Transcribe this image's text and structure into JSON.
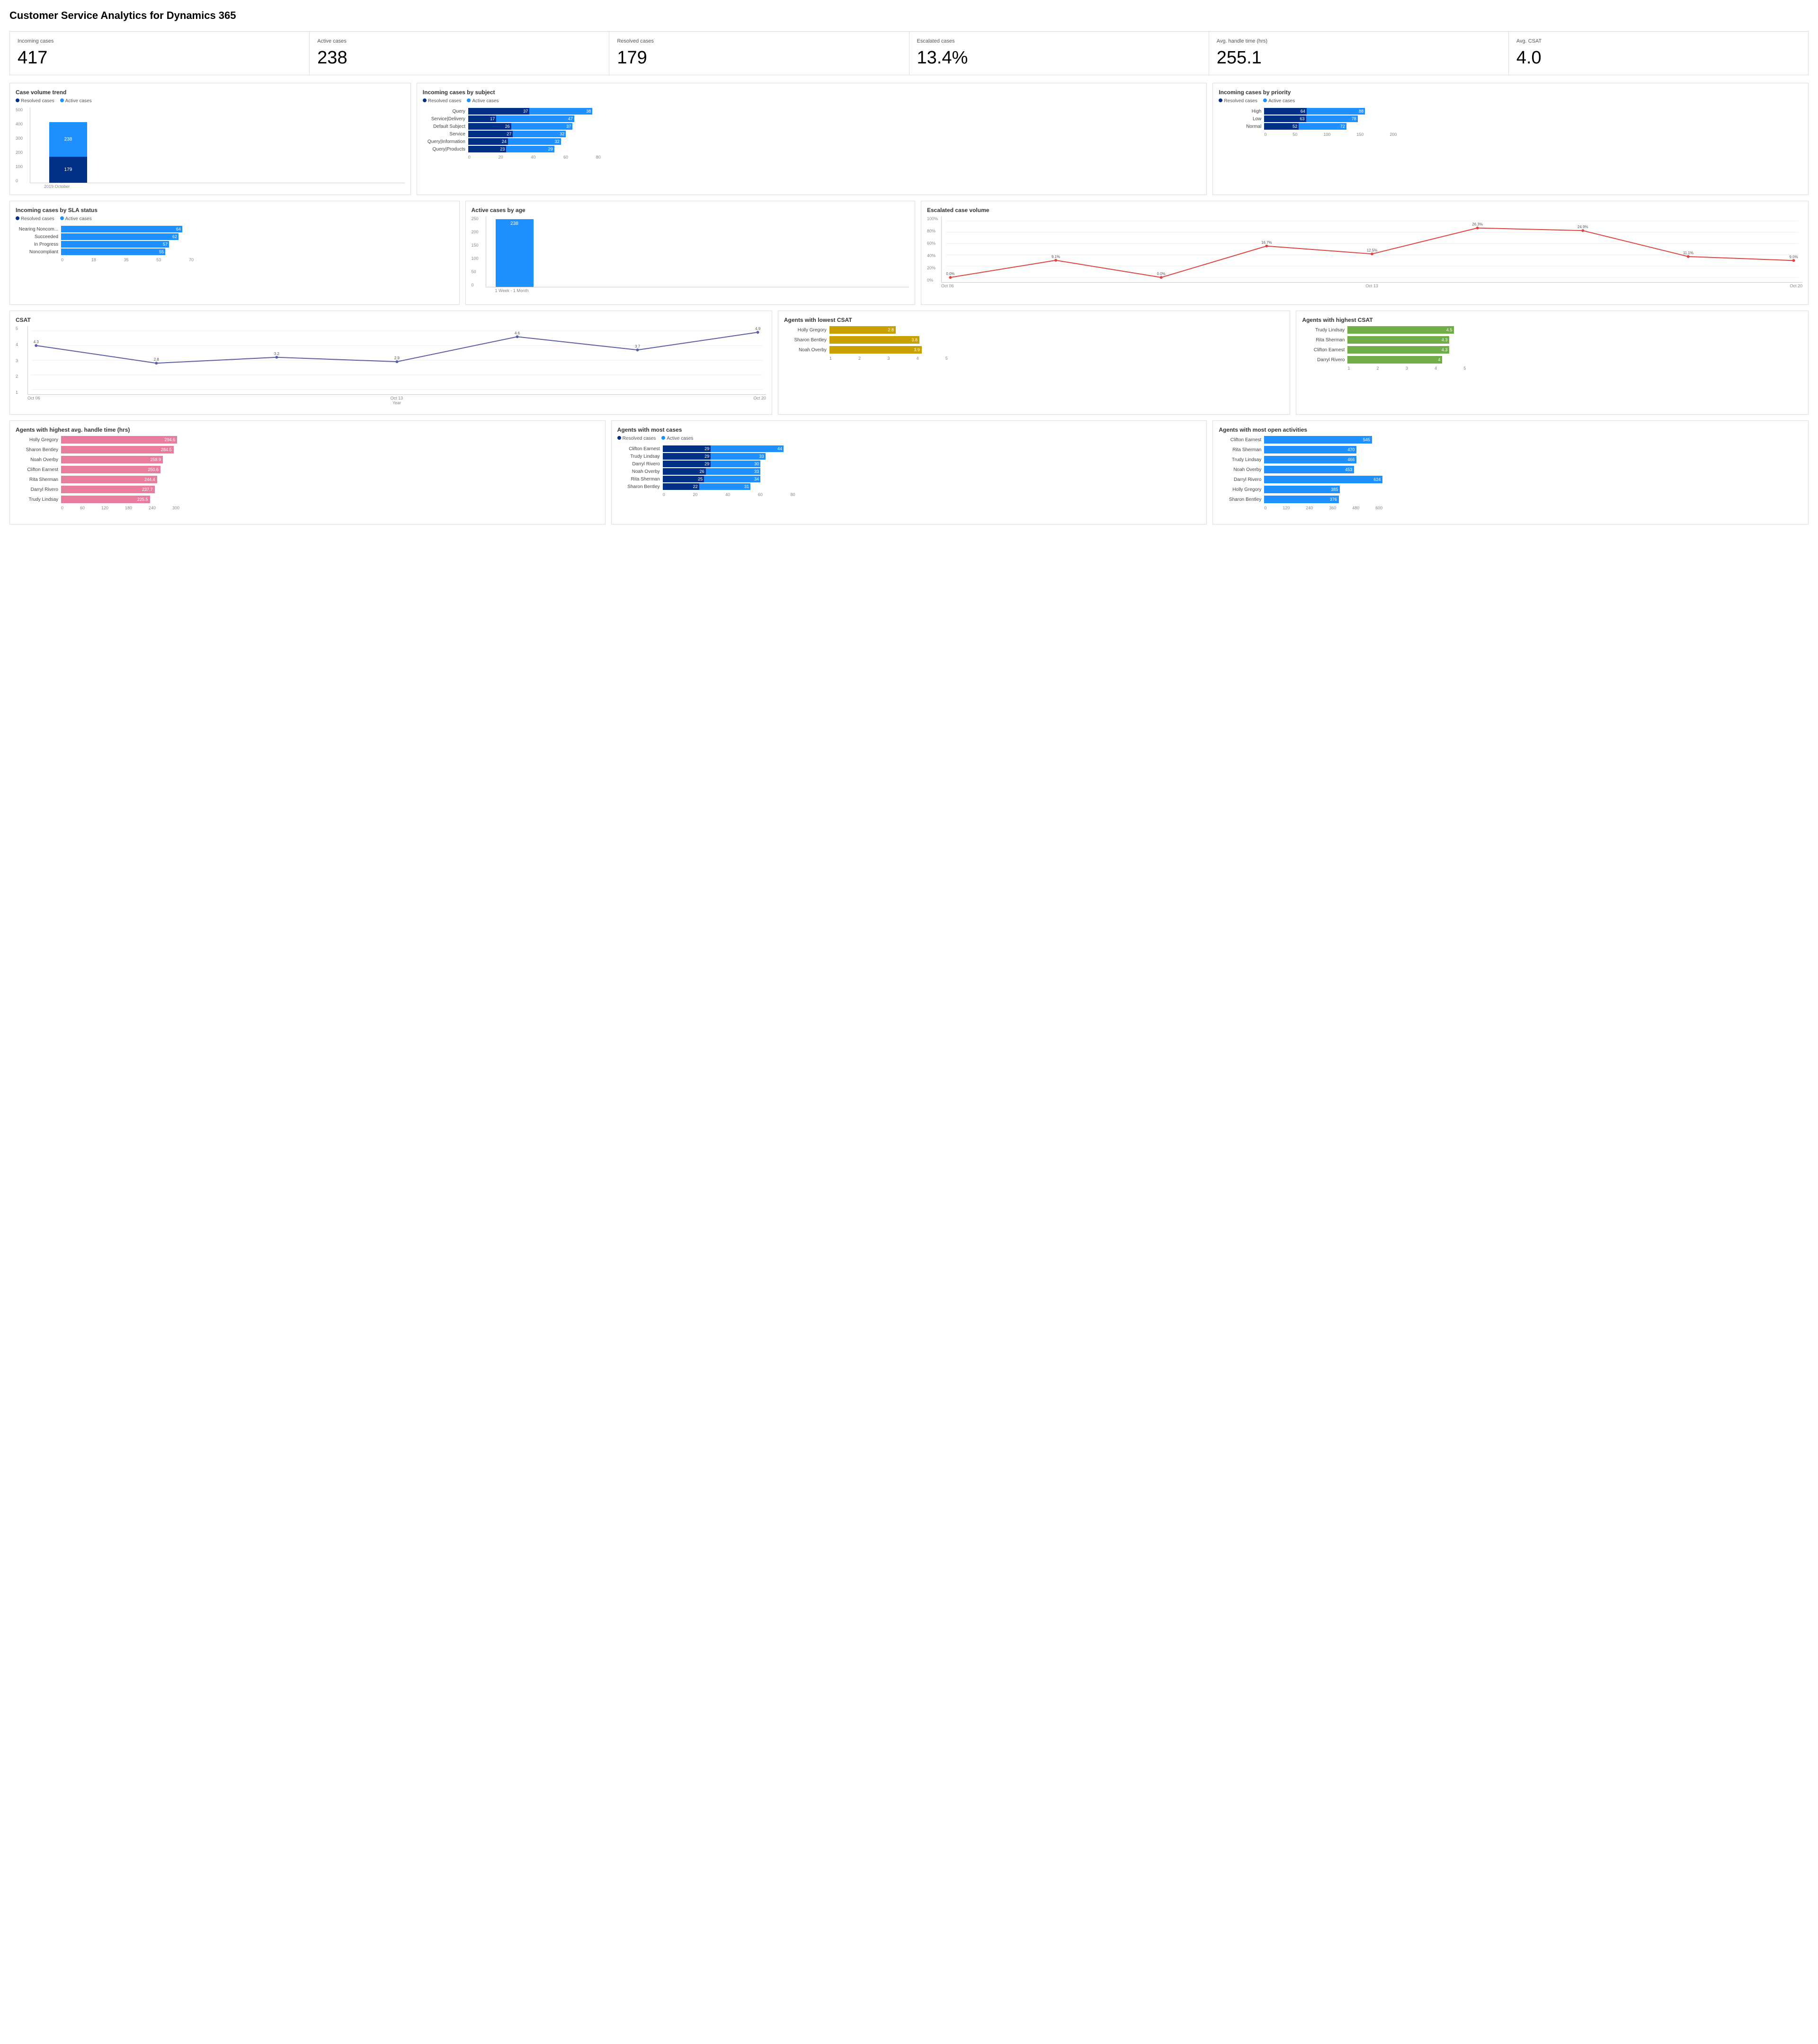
{
  "title": "Customer Service Analytics for Dynamics 365",
  "kpis": [
    {
      "label": "Incoming cases",
      "value": "417"
    },
    {
      "label": "Active cases",
      "value": "238"
    },
    {
      "label": "Resolved cases",
      "value": "179"
    },
    {
      "label": "Escalated cases",
      "value": "13.4%"
    },
    {
      "label": "Avg. handle time (hrs)",
      "value": "255.1"
    },
    {
      "label": "Avg. CSAT",
      "value": "4.0"
    }
  ],
  "colors": {
    "resolved": "#003087",
    "active": "#1e90ff",
    "green": "#70ad47",
    "yellow": "#c8a000",
    "pink": "#e87d9e",
    "escalated_line": "#d55"
  },
  "case_volume_trend": {
    "title": "Case volume trend",
    "legend": [
      "Resolved cases",
      "Active cases"
    ],
    "bar_label": "2019 October",
    "resolved_val": "179",
    "active_val": "238",
    "resolved_pct": 43,
    "active_pct": 57
  },
  "incoming_by_subject": {
    "title": "Incoming cases by subject",
    "legend": [
      "Resolved cases",
      "Active cases"
    ],
    "rows": [
      {
        "label": "Query",
        "resolved": 37,
        "active": 38
      },
      {
        "label": "Service|Delivery",
        "resolved": 17,
        "active": 47
      },
      {
        "label": "Default Subject",
        "resolved": 26,
        "active": 37
      },
      {
        "label": "Service",
        "resolved": 27,
        "active": 32
      },
      {
        "label": "Query|Information",
        "resolved": 24,
        "active": 32
      },
      {
        "label": "Query|Products",
        "resolved": 23,
        "active": 29
      }
    ],
    "x_max": 80
  },
  "incoming_by_priority": {
    "title": "Incoming cases by priority",
    "legend": [
      "Resolved cases",
      "Active cases"
    ],
    "rows": [
      {
        "label": "High",
        "resolved": 64,
        "active": 88
      },
      {
        "label": "Low",
        "resolved": 63,
        "active": 78
      },
      {
        "label": "Normal",
        "resolved": 52,
        "active": 72
      }
    ],
    "x_max": 200
  },
  "incoming_by_sla": {
    "title": "Incoming cases by SLA status",
    "legend": [
      "Resolved cases",
      "Active cases"
    ],
    "rows": [
      {
        "label": "Nearing Noncom...",
        "resolved": 0,
        "active": 64
      },
      {
        "label": "Succeeded",
        "resolved": 0,
        "active": 62
      },
      {
        "label": "In Progress",
        "resolved": 0,
        "active": 57
      },
      {
        "label": "Noncompliant",
        "resolved": 0,
        "active": 55
      }
    ],
    "x_max": 70
  },
  "active_by_age": {
    "title": "Active cases by age",
    "bar_label": "1 Week - 1 Month",
    "value": "238",
    "y_labels": [
      "0",
      "50",
      "100",
      "150",
      "200",
      "250"
    ]
  },
  "escalated_volume": {
    "title": "Escalated case volume",
    "points": [
      {
        "x": 0,
        "y": 0.0,
        "label": "0.0%",
        "date": "Oct 06"
      },
      {
        "x": 1,
        "y": 9.1,
        "label": "9.1%"
      },
      {
        "x": 2,
        "y": 0.0,
        "label": "0.0%"
      },
      {
        "x": 3,
        "y": 16.7,
        "label": "16.7%"
      },
      {
        "x": 4,
        "y": 12.5,
        "label": "12.5%",
        "date": "Oct 13"
      },
      {
        "x": 5,
        "y": 26.3,
        "label": "26.3%"
      },
      {
        "x": 6,
        "y": 24.9,
        "label": "24.9%"
      },
      {
        "x": 7,
        "y": 11.1,
        "label": "11.1%"
      },
      {
        "x": 8,
        "y": 9.0,
        "label": "9.0%",
        "date": "Oct 20"
      }
    ],
    "y_labels": [
      "0%",
      "20%",
      "40%",
      "60%",
      "80%",
      "100%"
    ]
  },
  "csat": {
    "title": "CSAT",
    "x_label": "Year",
    "points": [
      {
        "x": 0,
        "y": 4.0,
        "label": "4.3",
        "date": "Oct 06"
      },
      {
        "x": 1,
        "y": 2.8,
        "label": "2.8"
      },
      {
        "x": 2,
        "y": 3.2,
        "label": "3.2"
      },
      {
        "x": 3,
        "y": 2.9,
        "label": "2.9"
      },
      {
        "x": 4,
        "y": 4.6,
        "label": "4.6",
        "date": "Oct 13"
      },
      {
        "x": 5,
        "y": 3.7,
        "label": "3.7"
      },
      {
        "x": 6,
        "y": 4.9,
        "label": "4.9",
        "date": "Oct 20"
      }
    ],
    "y_labels": [
      "1",
      "2",
      "3",
      "4",
      "5"
    ]
  },
  "lowest_csat": {
    "title": "Agents with lowest CSAT",
    "rows": [
      {
        "label": "Holly Gregory",
        "value": 2.8,
        "pct": 56
      },
      {
        "label": "Sharon Bentley",
        "value": 3.8,
        "pct": 76
      },
      {
        "label": "Noah Overby",
        "value": 3.9,
        "pct": 78
      }
    ],
    "x_max": 5
  },
  "highest_csat": {
    "title": "Agents with highest CSAT",
    "rows": [
      {
        "label": "Trudy Lindsay",
        "value": 4.5,
        "pct": 90
      },
      {
        "label": "Rita Sherman",
        "value": 4.3,
        "pct": 86
      },
      {
        "label": "Clifton Earnest",
        "value": 4.3,
        "pct": 86
      },
      {
        "label": "Darryl Rivero",
        "value": 4.0,
        "pct": 80
      }
    ],
    "x_max": 5
  },
  "highest_handle_time": {
    "title": "Agents with highest avg. handle time (hrs)",
    "rows": [
      {
        "label": "Holly Gregory",
        "value": 294.6,
        "pct": 98
      },
      {
        "label": "Sharon Bentley",
        "value": 284.5,
        "pct": 95
      },
      {
        "label": "Noah Overby",
        "value": 258.9,
        "pct": 86
      },
      {
        "label": "Clifton Earnest",
        "value": 250.6,
        "pct": 84
      },
      {
        "label": "Rita Sherman",
        "value": 244.4,
        "pct": 81
      },
      {
        "label": "Darryl Rivero",
        "value": 237.7,
        "pct": 79
      },
      {
        "label": "Trudy Lindsay",
        "value": 225.5,
        "pct": 75
      }
    ],
    "x_max": 300
  },
  "most_cases": {
    "title": "Agents with most cases",
    "legend": [
      "Resolved cases",
      "Active cases"
    ],
    "rows": [
      {
        "label": "Clifton Earnest",
        "resolved": 29,
        "active": 44
      },
      {
        "label": "Trudy Lindsay",
        "resolved": 29,
        "active": 33
      },
      {
        "label": "Darryl Rivero",
        "resolved": 29,
        "active": 30
      },
      {
        "label": "Noah Overby",
        "resolved": 26,
        "active": 33
      },
      {
        "label": "Rita Sherman",
        "resolved": 25,
        "active": 34
      },
      {
        "label": "Sharon Bentley",
        "resolved": 22,
        "active": 31
      }
    ],
    "x_max": 80
  },
  "most_open_activities": {
    "title": "Agents with most open activities",
    "rows": [
      {
        "label": "Clifton Earnest",
        "value": 545,
        "pct": 91
      },
      {
        "label": "Rita Sherman",
        "value": 470,
        "pct": 78
      },
      {
        "label": "Trudy Lindsay",
        "value": 466,
        "pct": 78
      },
      {
        "label": "Noah Overby",
        "value": 453,
        "pct": 76
      },
      {
        "label": "Darryl Rivero",
        "value": 624,
        "pct": 100
      },
      {
        "label": "Holly Gregory",
        "value": 385,
        "pct": 64
      },
      {
        "label": "Sharon Bentley",
        "value": 376,
        "pct": 63
      }
    ],
    "x_max": 600
  }
}
